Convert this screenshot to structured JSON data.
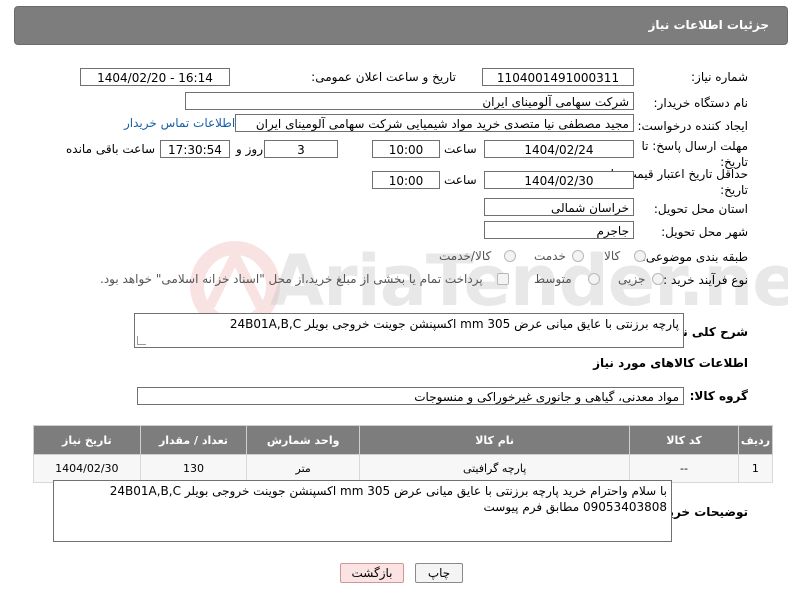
{
  "header": {
    "title": "جزئیات اطلاعات نیاز"
  },
  "watermark": {
    "text": "AriaTender.neT"
  },
  "fields": {
    "need_number_label": "شماره نیاز:",
    "need_number": "1104001491000311",
    "announce_label": "تاریخ و ساعت اعلان عمومی:",
    "announce_value": "1404/02/20 - 16:14",
    "buyer_org_label": "نام دستگاه خریدار:",
    "buyer_org": "شرکت سهامی آلومینای ایران",
    "requester_label": "ایجاد کننده درخواست:",
    "requester": "مجید مصطفی نیا متصدی خرید مواد شیمیایی شرکت سهامی آلومینای ایران",
    "contact_link": "اطلاعات تماس خریدار",
    "reply_deadline_label": "مهلت ارسال پاسخ: تا تاریخ:",
    "reply_date": "1404/02/24",
    "time_label": "ساعت",
    "reply_time": "10:00",
    "days_value": "3",
    "days_label": "روز و",
    "remaining_time": "17:30:54",
    "remaining_label": "ساعت باقی مانده",
    "price_validity_label": "حداقل تاریخ اعتبار قیمت: تا تاریخ:",
    "price_date": "1404/02/30",
    "price_time": "10:00",
    "province_label": "استان محل تحویل:",
    "province": "خراسان شمالی",
    "city_label": "شهر محل تحویل:",
    "city": "جاجرم",
    "category_label": "طبقه بندی موضوعی:",
    "category_options": [
      "کالا",
      "خدمت",
      "کالا/خدمت"
    ],
    "process_label": "نوع فرآیند خرید :",
    "process_options": [
      "جزیی",
      "متوسط"
    ],
    "payment_note": "پرداخت تمام یا بخشی از مبلغ خرید،از محل \"اسناد خزانه اسلامی\" خواهد بود."
  },
  "description": {
    "label": "شرح کلی نیاز:",
    "text": "پارچه برزنتی با عایق میانی عرض 305 mm اکسپنشن جوینت خروجی  بویلر 24B01A,B,C"
  },
  "goods_info": {
    "title": "اطلاعات کالاهای مورد نیاز",
    "group_label": "گروه کالا:",
    "group_value": "مواد معدنی، گیاهی و جانوری غیرخوراکی و منسوجات"
  },
  "table": {
    "headers": [
      "ردیف",
      "کد کالا",
      "نام کالا",
      "واحد شمارش",
      "تعداد / مقدار",
      "تاریخ نیاز"
    ],
    "rows": [
      [
        "1",
        "--",
        "پارچه گرافیتی",
        "متر",
        "130",
        "1404/02/30"
      ]
    ]
  },
  "buyer_notes": {
    "label": "توضیحات خریدار:",
    "line1": "با سلام واحترام خرید پارچه برزنتی با عایق میانی عرض 305 mm اکسپنشن جوینت خروجی  بویلر 24B01A,B,C",
    "line2": "09053403808 مطابق فرم پیوست"
  },
  "buttons": {
    "print": "چاپ",
    "back": "بازگشت"
  }
}
